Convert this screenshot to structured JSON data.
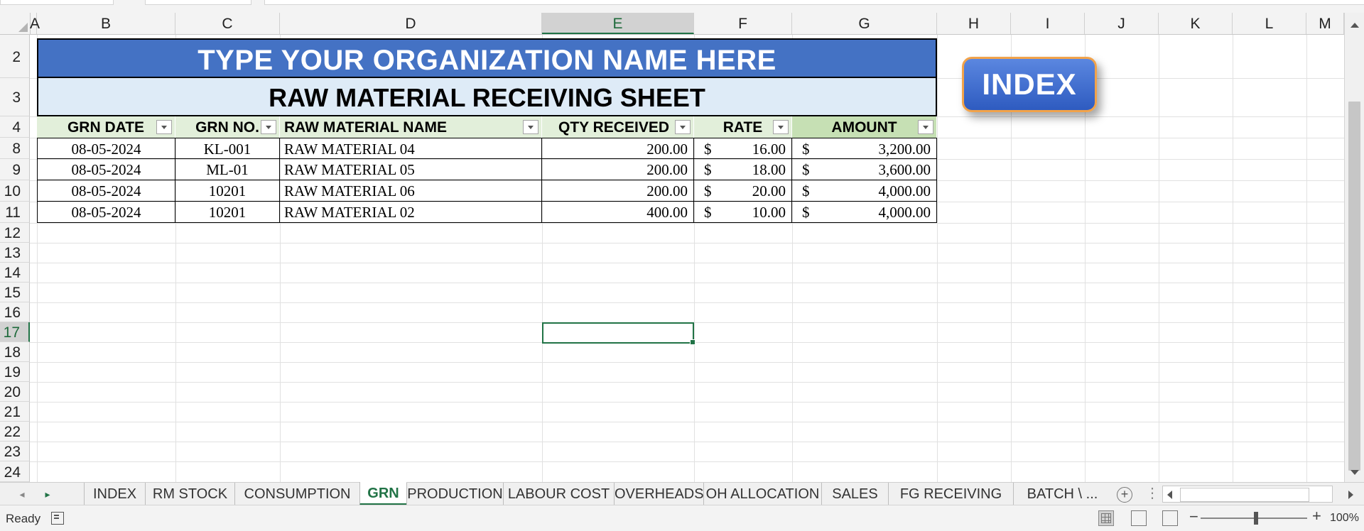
{
  "columns": [
    "A",
    "B",
    "C",
    "D",
    "E",
    "F",
    "G",
    "H",
    "I",
    "J",
    "K",
    "L",
    "M"
  ],
  "rows": [
    "2",
    "3",
    "4",
    "8",
    "9",
    "10",
    "11",
    "12",
    "13",
    "14",
    "15",
    "16",
    "17",
    "18",
    "19",
    "20",
    "21",
    "22",
    "23",
    "24"
  ],
  "selected_column": "E",
  "selected_row": "17",
  "sheet": {
    "org_name": "TYPE YOUR ORGANIZATION NAME HERE",
    "title": "RAW MATERIAL RECEIVING SHEET",
    "headers": [
      "GRN DATE",
      "GRN NO.",
      "RAW MATERIAL NAME",
      "QTY RECEIVED",
      "RATE",
      "AMOUNT"
    ],
    "currency": "$",
    "rows": [
      {
        "date": "08-05-2024",
        "grn": "KL-001",
        "name": "RAW MATERIAL 04",
        "qty": "200.00",
        "rate": "16.00",
        "amount": "3,200.00"
      },
      {
        "date": "08-05-2024",
        "grn": "ML-01",
        "name": "RAW MATERIAL 05",
        "qty": "200.00",
        "rate": "18.00",
        "amount": "3,600.00"
      },
      {
        "date": "08-05-2024",
        "grn": "10201",
        "name": "RAW MATERIAL 06",
        "qty": "200.00",
        "rate": "20.00",
        "amount": "4,000.00"
      },
      {
        "date": "08-05-2024",
        "grn": "10201",
        "name": "RAW MATERIAL 02",
        "qty": "400.00",
        "rate": "10.00",
        "amount": "4,000.00"
      }
    ]
  },
  "index_button": "INDEX",
  "tabs": [
    "INDEX",
    "RM STOCK",
    "CONSUMPTION",
    "GRN",
    "PRODUCTION",
    "LABOUR COST",
    "OVERHEADS",
    "OH ALLOCATION",
    "SALES",
    "FG RECEIVING",
    "BATCH \\ ..."
  ],
  "active_tab": "GRN",
  "status": {
    "ready": "Ready",
    "zoom": "100%"
  },
  "colors": {
    "accent": "#217346",
    "org_bg": "#4472c4",
    "title_bg": "#deebf7",
    "header_bg": "#e2efda",
    "amount_header_bg": "#c6e0b4",
    "button_border": "#f2a34a"
  }
}
